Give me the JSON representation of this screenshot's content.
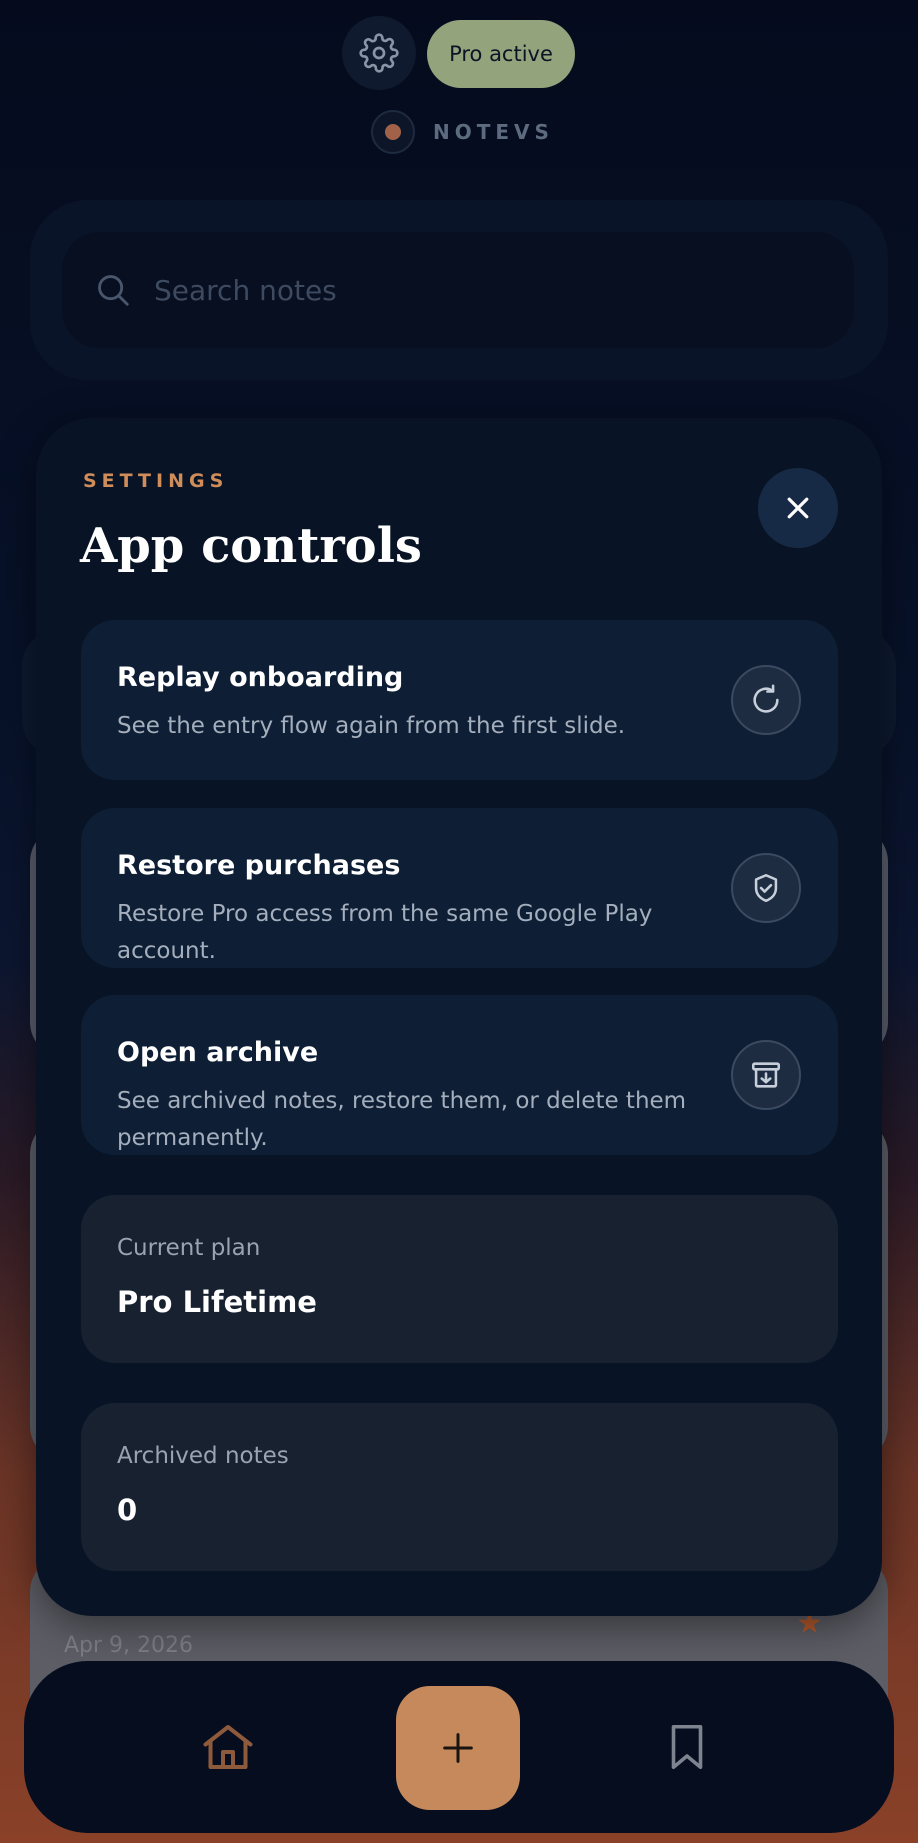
{
  "header": {
    "pro_badge": "Pro active",
    "brand": "NOTEVS"
  },
  "search": {
    "placeholder": "Search notes"
  },
  "background_note": {
    "date": "Apr 9, 2026"
  },
  "settings": {
    "eyebrow": "SETTINGS",
    "title": "App controls",
    "actions": [
      {
        "title": "Replay onboarding",
        "description": "See the entry flow again from the first slide.",
        "icon": "refresh-icon"
      },
      {
        "title": "Restore purchases",
        "description": "Restore Pro access from the same Google Play account.",
        "icon": "shield-check-icon"
      },
      {
        "title": "Open archive",
        "description": "See archived notes, restore them, or delete them permanently.",
        "icon": "archive-icon"
      }
    ],
    "stats": [
      {
        "label": "Current plan",
        "value": "Pro Lifetime"
      },
      {
        "label": "Archived notes",
        "value": "0"
      }
    ]
  },
  "nav": {
    "items": [
      "home-icon",
      "plus-icon",
      "bookmark-icon"
    ]
  },
  "colors": {
    "accent": "#c6895b",
    "pro_badge": "#93a37c",
    "sheet": "#081425",
    "eyebrow": "#d08d5a"
  }
}
